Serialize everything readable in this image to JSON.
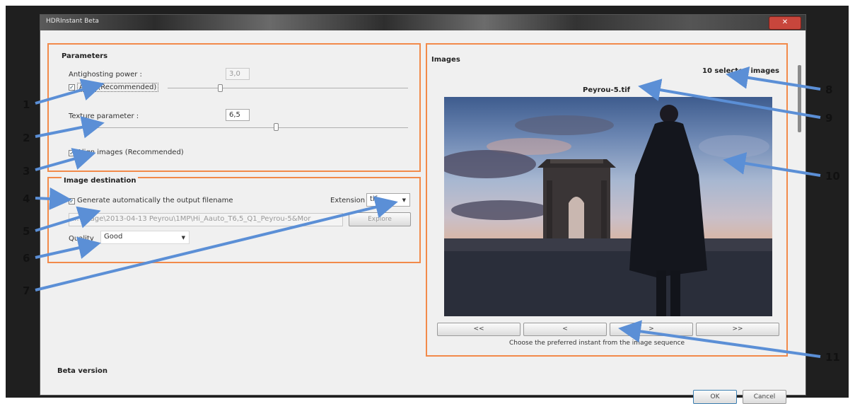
{
  "window": {
    "title": "HDRInstant Beta",
    "close_glyph": "✕"
  },
  "parameters": {
    "heading": "Parameters",
    "antighosting_label": "Antighosting power :",
    "antighosting_value": "3,0",
    "auto_label": "Auto (Recommended)",
    "auto_checked": true,
    "antighosting_level": 0.35,
    "texture_label": "Texture parameter :",
    "texture_value": "6,5",
    "texture_level": 0.65,
    "align_label": "Align images (Recommended)",
    "align_checked": true
  },
  "destination": {
    "heading": "Image destination",
    "generate_label": "Generate automatically the output filename",
    "generate_checked": true,
    "extension_label": "Extension",
    "extension_value": "tif",
    "path_value": "...\\Image\\2013-04-13 Peyrou\\1MP\\Hi_Aauto_T6,5_Q1_Peyrou-5&Mor",
    "explore_label": "Explore",
    "quality_label": "Quality",
    "quality_value": "Good"
  },
  "images": {
    "heading": "Images",
    "selected_count": "10 selected images",
    "current_filename": "Peyrou-5.tif",
    "nav": {
      "first": "<<",
      "prev": "<",
      "next": ">",
      "last": ">>"
    },
    "hint": "Choose the preferred instant from the image sequence"
  },
  "footer": {
    "beta_label": "Beta version",
    "ok_label": "OK",
    "cancel_label": "Cancel"
  },
  "callouts": [
    "1",
    "2",
    "3",
    "4",
    "5",
    "6",
    "7",
    "8",
    "9",
    "10",
    "11"
  ],
  "colors": {
    "highlight_box": "#f28a4a",
    "callout_arrow": "#5b8fd6",
    "close_button": "#c8463c"
  }
}
